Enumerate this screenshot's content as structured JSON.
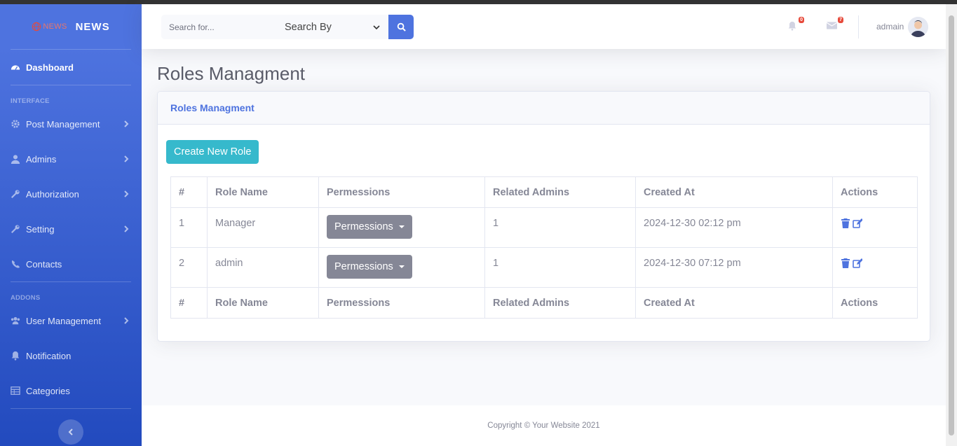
{
  "brand": {
    "logo_text": "NEWS",
    "name": "NEWS"
  },
  "sidebar": {
    "dashboard": "Dashboard",
    "heading_interface": "INTERFACE",
    "heading_addons": "ADDONS",
    "items": [
      {
        "label": "Post Management",
        "icon": "cog-icon"
      },
      {
        "label": "Admins",
        "icon": "user-icon"
      },
      {
        "label": "Authorization",
        "icon": "wrench-icon"
      },
      {
        "label": "Setting",
        "icon": "wrench-icon"
      },
      {
        "label": "Contacts",
        "icon": "phone-icon"
      },
      {
        "label": "User Management",
        "icon": "users-icon"
      },
      {
        "label": "Notification",
        "icon": "bell-icon"
      },
      {
        "label": "Categories",
        "icon": "table-icon"
      }
    ]
  },
  "topbar": {
    "search_placeholder": "Search for...",
    "search_by": "Search By",
    "alerts_count": "0",
    "messages_count": "7",
    "user_name": "admain"
  },
  "page": {
    "title": "Roles Managment",
    "card_title": "Roles Managment",
    "create_button": "Create New Role"
  },
  "table": {
    "headers": [
      "#",
      "Role Name",
      "Permessions",
      "Related Admins",
      "Created At",
      "Actions"
    ],
    "rows": [
      {
        "num": "1",
        "role": "Manager",
        "perm_button": "Permessions",
        "admins": "1",
        "created": "2024-12-30 02:12 pm"
      },
      {
        "num": "2",
        "role": "admin",
        "perm_button": "Permessions",
        "admins": "1",
        "created": "2024-12-30 07:12 pm"
      }
    ]
  },
  "footer": {
    "copyright": "Copyright © Your Website 2021"
  }
}
